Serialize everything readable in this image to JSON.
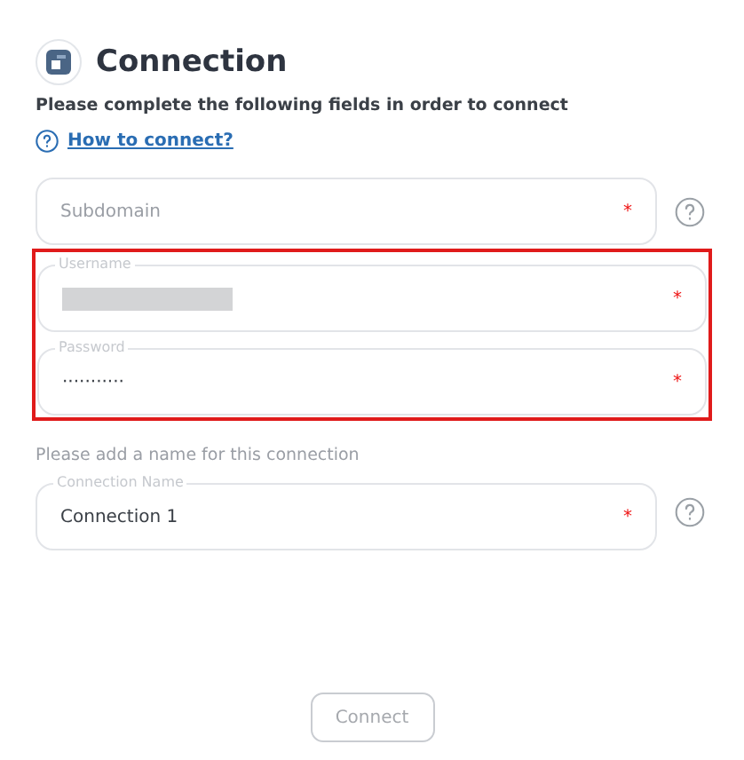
{
  "header": {
    "title": "Connection"
  },
  "intro": "Please complete the following fields in order to connect",
  "help_link": {
    "label": "How to connect?"
  },
  "fields": [
    {
      "placeholder": "Subdomain",
      "required_mark": "*",
      "help": true
    }
  ],
  "highlighted_group": {
    "fields": [
      {
        "label": "Username",
        "required_mark": "*",
        "redacted": true
      },
      {
        "label": "Password",
        "value": "···········",
        "required_mark": "*"
      }
    ]
  },
  "name_section": {
    "prompt": "Please add a name for this connection",
    "field": {
      "label": "Connection Name",
      "value": "Connection 1",
      "required_mark": "*",
      "help": true
    }
  },
  "connect_button": {
    "label": "Connect",
    "disabled": true
  }
}
